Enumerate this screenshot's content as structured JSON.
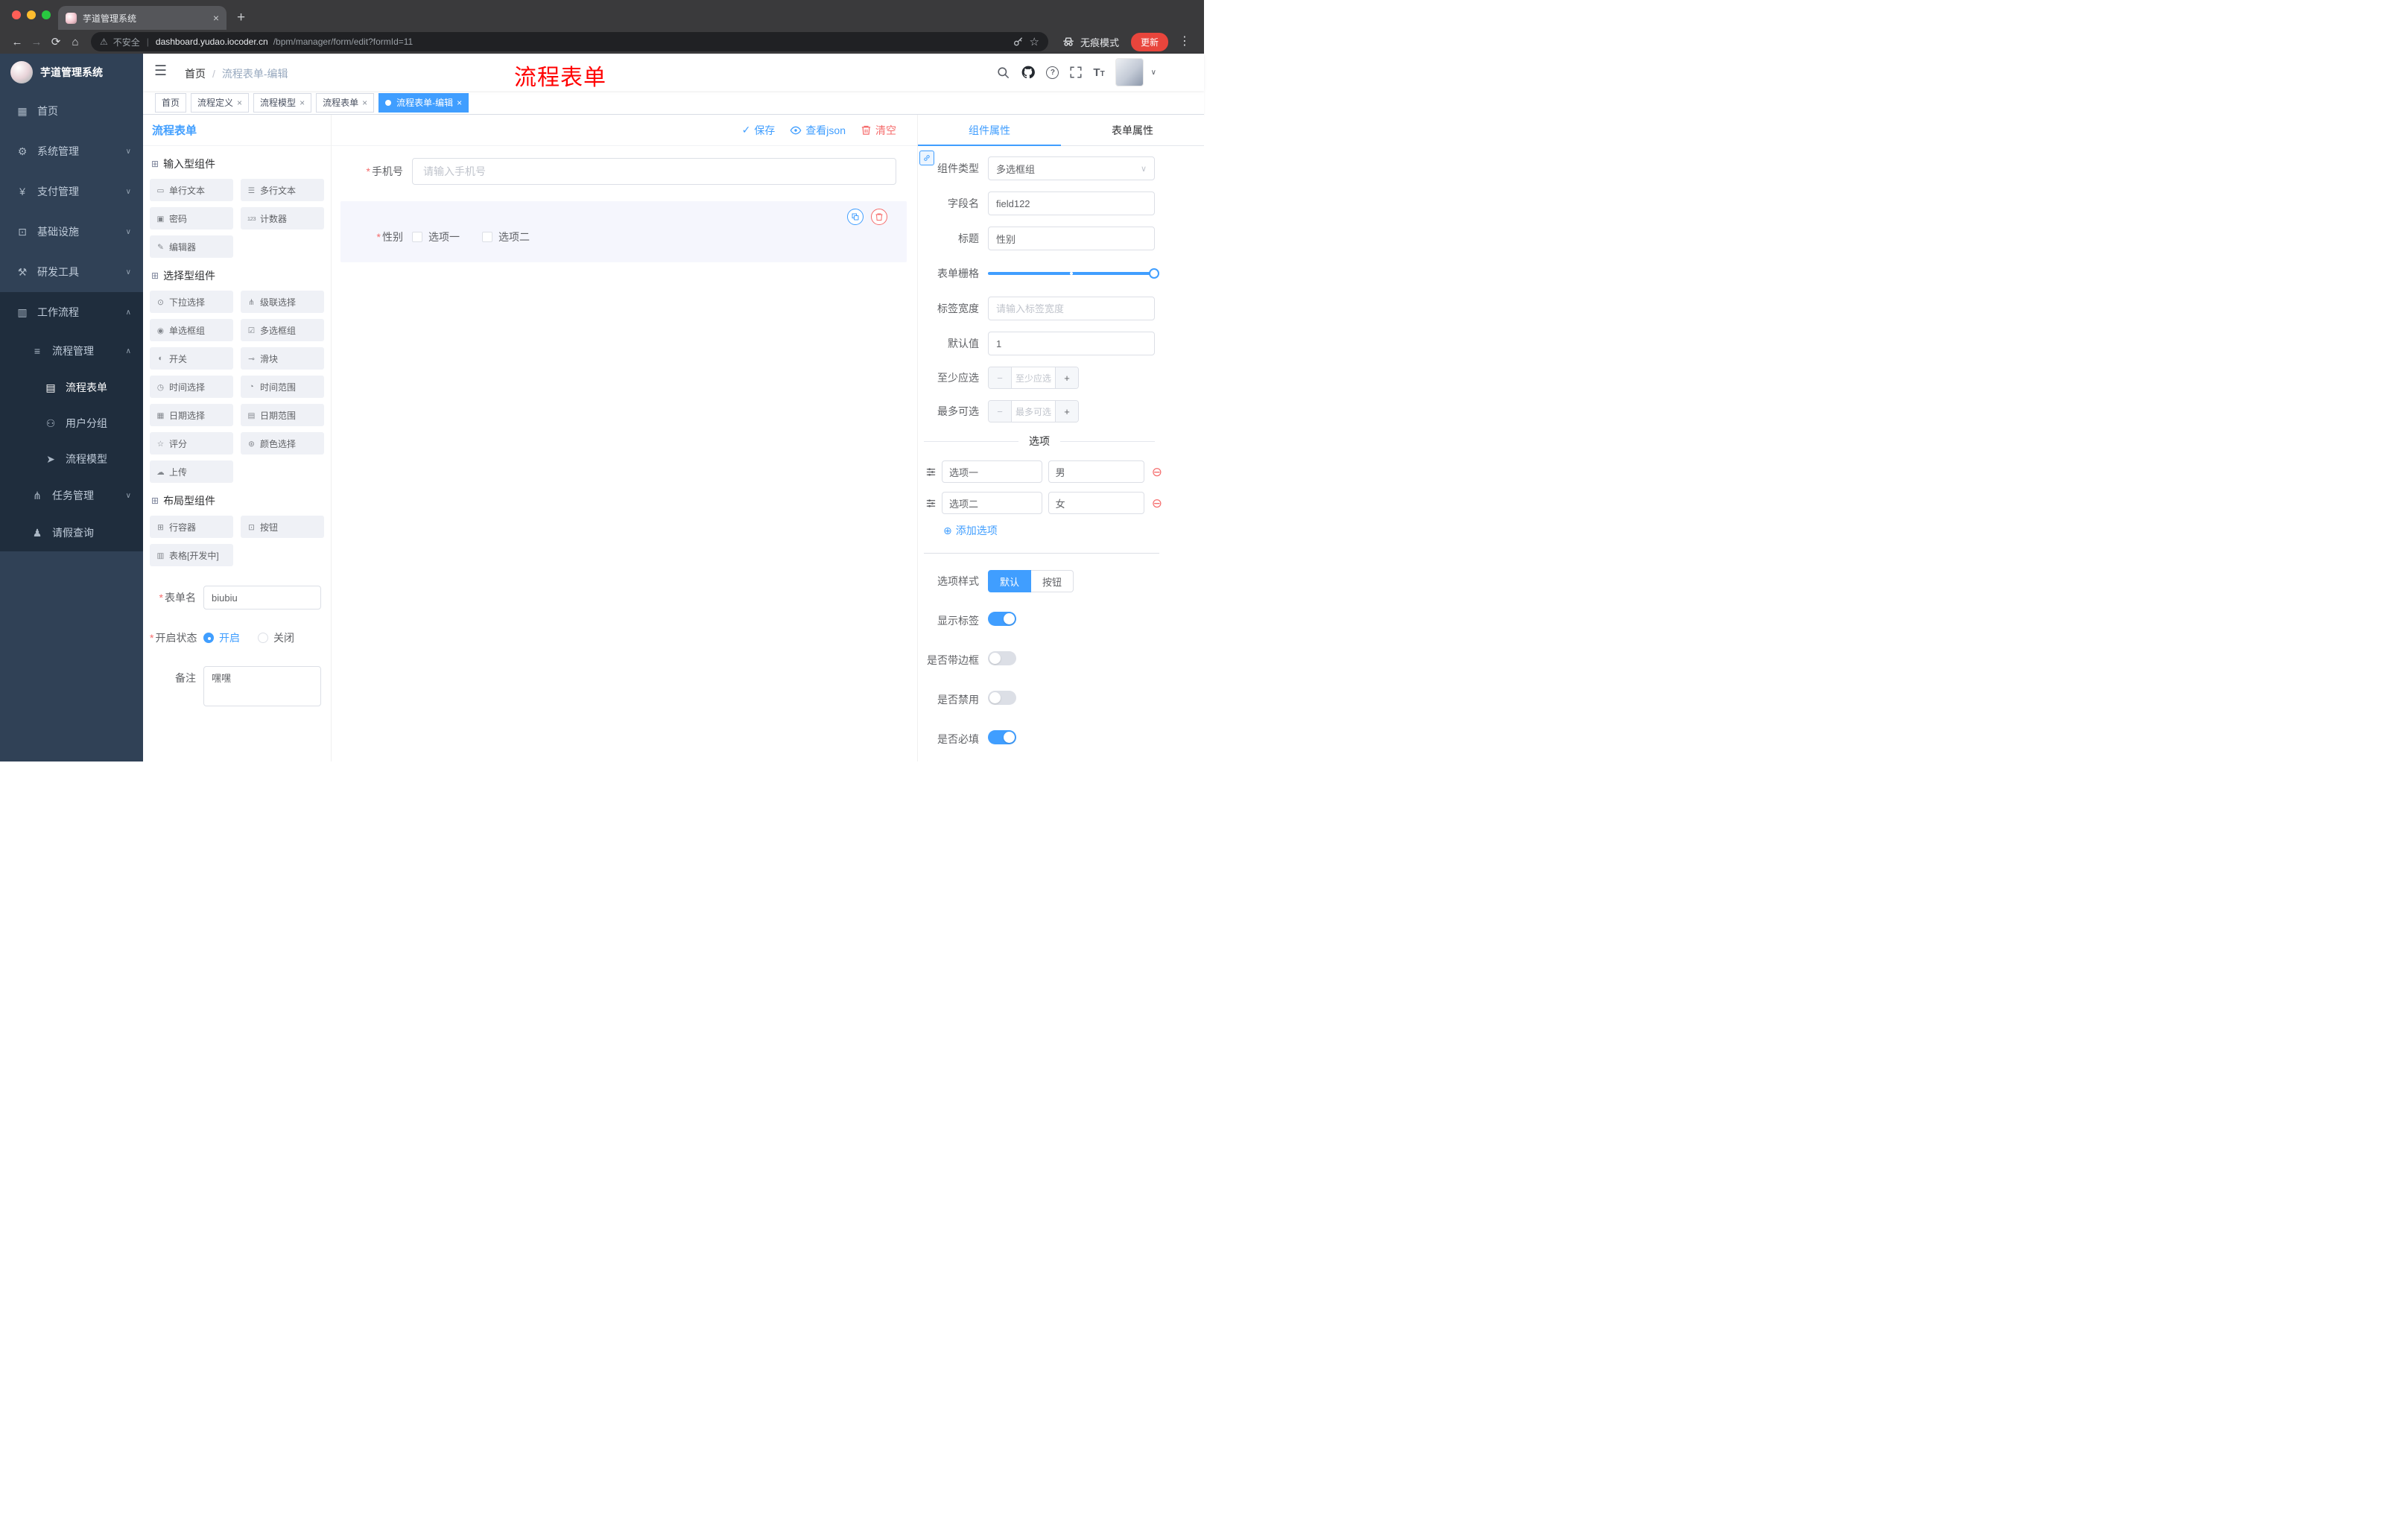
{
  "glyphs": {
    "back": "←",
    "forward": "→",
    "reload": "⟳",
    "home": "⌂",
    "new_tab": "+",
    "close": "×",
    "warning": "⚠",
    "divider": "|",
    "star": "☆",
    "menu_dots": "⋮",
    "caret_down": "∨",
    "caret_up": "∧",
    "hamburger": "☰",
    "help": "?",
    "text_size": "T",
    "slash": "/",
    "check": "✓",
    "required": "*",
    "add": "⊕",
    "remove": "⊖",
    "minus": "−",
    "plus": "+",
    "component": "⊞"
  },
  "browser": {
    "tab_title": "芋道管理系统",
    "security_label": "不安全",
    "url_host": "dashboard.yudao.iocoder.cn",
    "url_path": "/bpm/manager/form/edit?formId=11",
    "incognito_label": "无痕模式",
    "update_label": "更新"
  },
  "sidebar": {
    "logo_title": "芋道管理系统",
    "items": [
      {
        "label": "首页",
        "glyph": "▦"
      },
      {
        "label": "系统管理",
        "glyph": "⚙"
      },
      {
        "label": "支付管理",
        "glyph": "¥"
      },
      {
        "label": "基础设施",
        "glyph": "⊡"
      },
      {
        "label": "研发工具",
        "glyph": "⚒"
      },
      {
        "label": "工作流程",
        "glyph": "▥"
      },
      {
        "label": "流程管理",
        "glyph": "≡"
      },
      {
        "label": "流程表单",
        "glyph": "▤"
      },
      {
        "label": "用户分组",
        "glyph": "⚇"
      },
      {
        "label": "流程模型",
        "glyph": "➤"
      },
      {
        "label": "任务管理",
        "glyph": "⋔"
      },
      {
        "label": "请假查询",
        "glyph": "♟"
      }
    ]
  },
  "header": {
    "breadcrumb_home": "首页",
    "breadcrumb_current": "流程表单-编辑",
    "annotation": "流程表单"
  },
  "tags": [
    {
      "label": "首页"
    },
    {
      "label": "流程定义"
    },
    {
      "label": "流程模型"
    },
    {
      "label": "流程表单"
    },
    {
      "label": "流程表单-编辑"
    }
  ],
  "designer": {
    "panel_title": "流程表单",
    "actions": {
      "save": "保存",
      "view_json": "查看json",
      "clear": "清空"
    },
    "groups": [
      {
        "title": "输入型组件",
        "items": [
          {
            "label": "单行文本",
            "glyph": "▭"
          },
          {
            "label": "多行文本",
            "glyph": "☰"
          },
          {
            "label": "密码",
            "glyph": "▣"
          },
          {
            "label": "计数器",
            "glyph": "123"
          },
          {
            "label": "编辑器",
            "glyph": "✎"
          }
        ]
      },
      {
        "title": "选择型组件",
        "items": [
          {
            "label": "下拉选择",
            "glyph": "⊙"
          },
          {
            "label": "级联选择",
            "glyph": "⋔"
          },
          {
            "label": "单选框组",
            "glyph": "◉"
          },
          {
            "label": "多选框组",
            "glyph": "☑"
          },
          {
            "label": "开关",
            "glyph": "◐"
          },
          {
            "label": "滑块",
            "glyph": "⊸"
          },
          {
            "label": "时间选择",
            "glyph": "◷"
          },
          {
            "label": "时间范围",
            "glyph": "◔"
          },
          {
            "label": "日期选择",
            "glyph": "▦"
          },
          {
            "label": "日期范围",
            "glyph": "▤"
          },
          {
            "label": "评分",
            "glyph": "☆"
          },
          {
            "label": "颜色选择",
            "glyph": "⊛"
          },
          {
            "label": "上传",
            "glyph": "☁"
          }
        ]
      },
      {
        "title": "布局型组件",
        "items": [
          {
            "label": "行容器",
            "glyph": "⊞"
          },
          {
            "label": "按钮",
            "glyph": "⊡"
          },
          {
            "label": "表格[开发中]",
            "glyph": "▥"
          }
        ]
      }
    ],
    "meta": {
      "name_label": "表单名",
      "name_value": "biubiu",
      "status_label": "开启状态",
      "status_on": "开启",
      "status_off": "关闭",
      "remark_label": "备注",
      "remark_value": "嘿嘿"
    },
    "canvas": {
      "phone_label": "手机号",
      "phone_placeholder": "请输入手机号",
      "gender_label": "性别",
      "gender_options": [
        {
          "label": "选项一"
        },
        {
          "label": "选项二"
        }
      ]
    }
  },
  "props": {
    "tab_component": "组件属性",
    "tab_form": "表单属性",
    "component_type_label": "组件类型",
    "component_type_value": "多选框组",
    "field_name_label": "字段名",
    "field_name_value": "field122",
    "title_label": "标题",
    "title_value": "性别",
    "grid_label": "表单栅格",
    "label_width_label": "标签宽度",
    "label_width_placeholder": "请输入标签宽度",
    "default_label": "默认值",
    "default_value": "1",
    "min_label": "至少应选",
    "min_placeholder": "至少应选",
    "max_label": "最多可选",
    "max_placeholder": "最多可选",
    "options_divider": "选项",
    "options": [
      {
        "label": "选项一",
        "value": "男"
      },
      {
        "label": "选项二",
        "value": "女"
      }
    ],
    "add_option": "添加选项",
    "style_label": "选项样式",
    "style_default": "默认",
    "style_button": "按钮",
    "switch_rows": [
      {
        "label": "显示标签"
      },
      {
        "label": "是否带边框"
      },
      {
        "label": "是否禁用"
      },
      {
        "label": "是否必填"
      }
    ]
  },
  "colors": {
    "accent": "#409eff",
    "danger": "#f56c6c",
    "annotation": "#ff0000",
    "sidebar_bg": "#304156",
    "sidebar_sub_bg": "#1f2d3d"
  }
}
